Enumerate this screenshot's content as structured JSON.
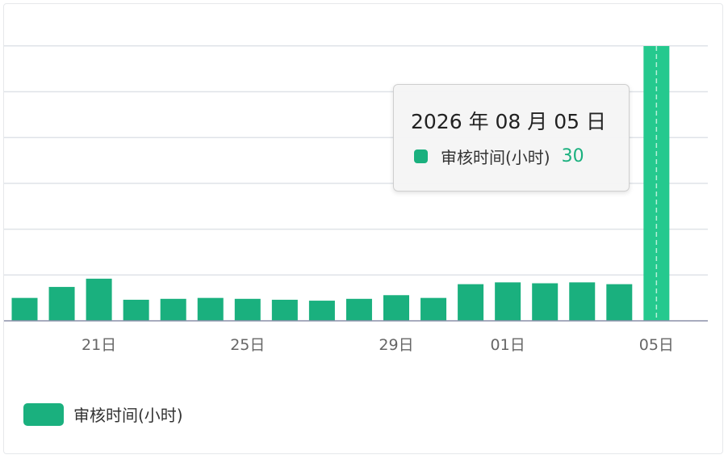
{
  "chart_data": {
    "type": "bar",
    "categories": [
      "",
      "",
      "21日",
      "",
      "",
      "",
      "25日",
      "",
      "",
      "",
      "29日",
      "",
      "01日",
      "",
      "",
      "",
      "05日"
    ],
    "series": [
      {
        "name": "审核时间(小时)",
        "values": [
          2.5,
          3.7,
          4.6,
          2.3,
          2.4,
          2.5,
          2.4,
          2.3,
          2.2,
          2.4,
          2.8,
          2.5,
          4.0,
          4.2,
          4.1,
          4.2,
          4.0,
          30
        ]
      }
    ],
    "x_tick_labels": [
      "21日",
      "25日",
      "29日",
      "01日",
      "05日"
    ],
    "ylim": [
      0,
      30
    ],
    "grid": true,
    "legend": "bottom-left",
    "highlighted_category": "05日",
    "colors": {
      "series": "#1ab07e",
      "highlight": "#25c98e",
      "grid": "#dfe3e8",
      "axis": "#8a8fa8",
      "crosshair": "#b6f0d8"
    }
  },
  "tooltip": {
    "title": "2026 年 08 月 05 日",
    "series_name": "审核时间(小时)",
    "value": "30"
  },
  "legend": {
    "label": "审核时间(小时)"
  }
}
